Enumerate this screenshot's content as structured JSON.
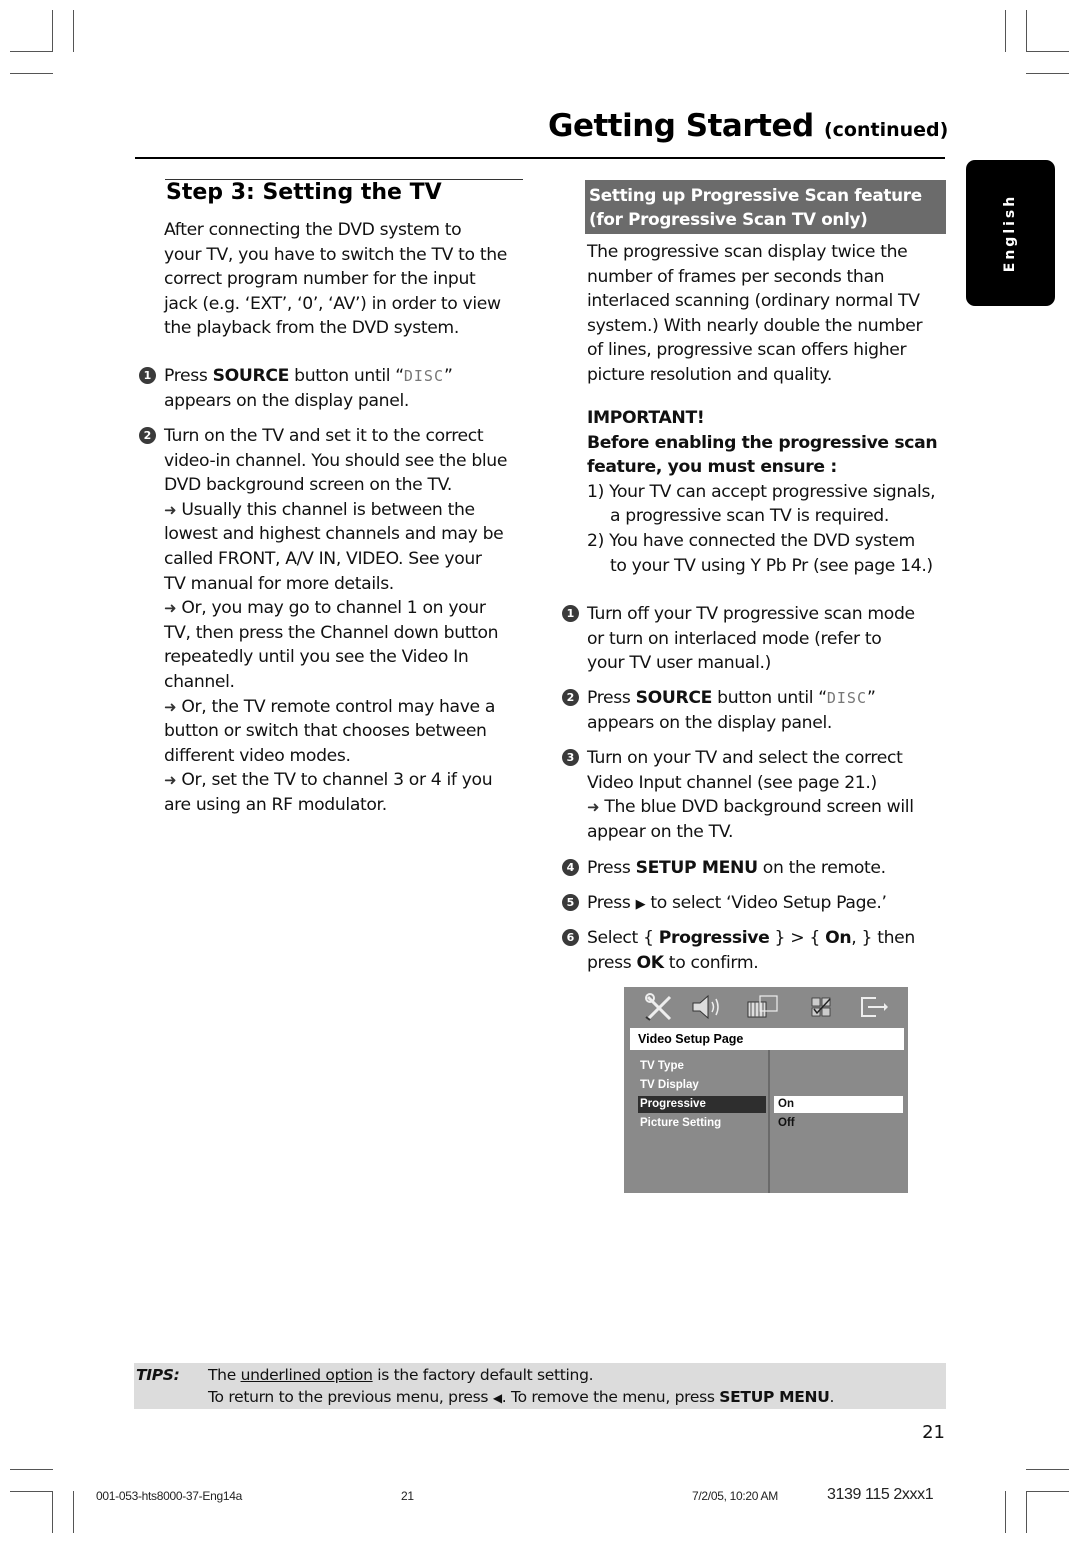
{
  "header": {
    "title": "Getting Started",
    "title_suffix": "(continued)"
  },
  "language_tab": "English",
  "left": {
    "step_heading": "Step 3:  Setting the TV",
    "intro_lines": [
      "After connecting the DVD system to",
      "your TV, you have to switch the TV to the",
      "correct program number for the input",
      "jack (e.g. ‘EXT’, ‘0’, ‘AV’) in order to view",
      "the playback from the DVD system."
    ],
    "steps": [
      {
        "number": "1",
        "lines": [
          {
            "pre": "Press ",
            "bold": "SOURCE",
            "post": " button until “",
            "lcd": "DISC",
            "end": "”"
          },
          {
            "text": "appears on the display panel."
          }
        ]
      },
      {
        "number": "2",
        "lines": [
          {
            "text": "Turn on the TV and set it to the correct"
          },
          {
            "text": "video-in channel. You should see the blue"
          },
          {
            "text": "DVD background screen on the TV."
          }
        ],
        "notes": [
          [
            "Usually this channel is between the",
            "lowest and highest channels and may be",
            "called FRONT, A/V IN, VIDEO. See your",
            "TV manual for more details."
          ],
          [
            "Or, you may go to channel 1 on your",
            "TV, then press the Channel down button",
            "repeatedly until you see the Video In",
            "channel."
          ],
          [
            "Or, the TV remote control may have a",
            "button or switch that chooses between",
            "different video modes."
          ],
          [
            "Or, set the TV to channel 3 or 4 if you",
            "are using an RF modulator."
          ]
        ]
      }
    ]
  },
  "right": {
    "section_title_lines": [
      "Setting up Progressive Scan feature",
      "(for Progressive Scan TV only)"
    ],
    "intro_lines": [
      "The progressive scan display twice the",
      "number of frames per seconds than",
      "interlaced scanning (ordinary normal TV",
      "system.)  With nearly double the number",
      "of lines, progressive scan offers higher",
      "picture resolution and quality."
    ],
    "important_label": "IMPORTANT!",
    "important_sub_lines": [
      "Before enabling the progressive scan",
      "feature, you must ensure :"
    ],
    "requirements": [
      {
        "marker": "1)",
        "lines": [
          "Your TV can accept progressive signals,",
          "a progressive scan TV is required."
        ]
      },
      {
        "marker": "2)",
        "lines": [
          "You have connected the DVD system",
          "to your TV using Y Pb Pr (see page 14.)"
        ]
      }
    ],
    "steps": [
      {
        "number": "1",
        "lines": [
          "Turn off your TV progressive scan mode",
          "or turn on interlaced mode (refer to",
          "your TV user manual.)"
        ]
      },
      {
        "number": "2",
        "pre": "Press ",
        "bold": "SOURCE",
        "post": " button until “",
        "lcd": "DISC",
        "end": "”",
        "line2": "appears on the display panel."
      },
      {
        "number": "3",
        "lines": [
          "Turn on your TV and select the correct",
          "Video Input channel (see page 21.)"
        ],
        "note_lines": [
          "The blue DVD background screen will",
          "appear on the TV."
        ]
      },
      {
        "number": "4",
        "pre": "Press ",
        "bold": "SETUP MENU",
        "post": " on the remote."
      },
      {
        "number": "5",
        "pre": "Press ",
        "glyph": "▶",
        "post": " to select ‘Video Setup Page.’"
      },
      {
        "number": "6",
        "pre": "Select { ",
        "bold": "Progressive",
        "mid": " } > { ",
        "bold2": "On",
        "post": ", } then",
        "line2_pre": "press ",
        "line2_bold": "OK",
        "line2_post": " to confirm."
      }
    ]
  },
  "osd": {
    "icons": [
      "general-setup-icon",
      "audio-setup-icon",
      "video-setup-icon",
      "preference-icon",
      "exit-icon"
    ],
    "header": "Video Setup Page",
    "menu_items": [
      "TV Type",
      "TV Display",
      "Progressive",
      "Picture Setting"
    ],
    "selected_item": "Progressive",
    "options": [
      "On",
      "Off"
    ],
    "selected_option": "On"
  },
  "tips": {
    "label": "TIPS:",
    "line1_pre": "The ",
    "line1_underlined": "underlined option",
    "line1_post": " is the factory default setting.",
    "line2_pre": "To return to the previous menu, press ",
    "line2_glyph": "◀",
    "line2_mid": ".  To remove the menu, press ",
    "line2_bold": "SETUP MENU",
    "line2_end": "."
  },
  "page_number": "21",
  "footer": {
    "file": "001-053-hts8000-37-Eng14a",
    "page": "21",
    "datetime": "7/2/05, 10:20 AM",
    "code": "3139 115 2xxx1"
  }
}
